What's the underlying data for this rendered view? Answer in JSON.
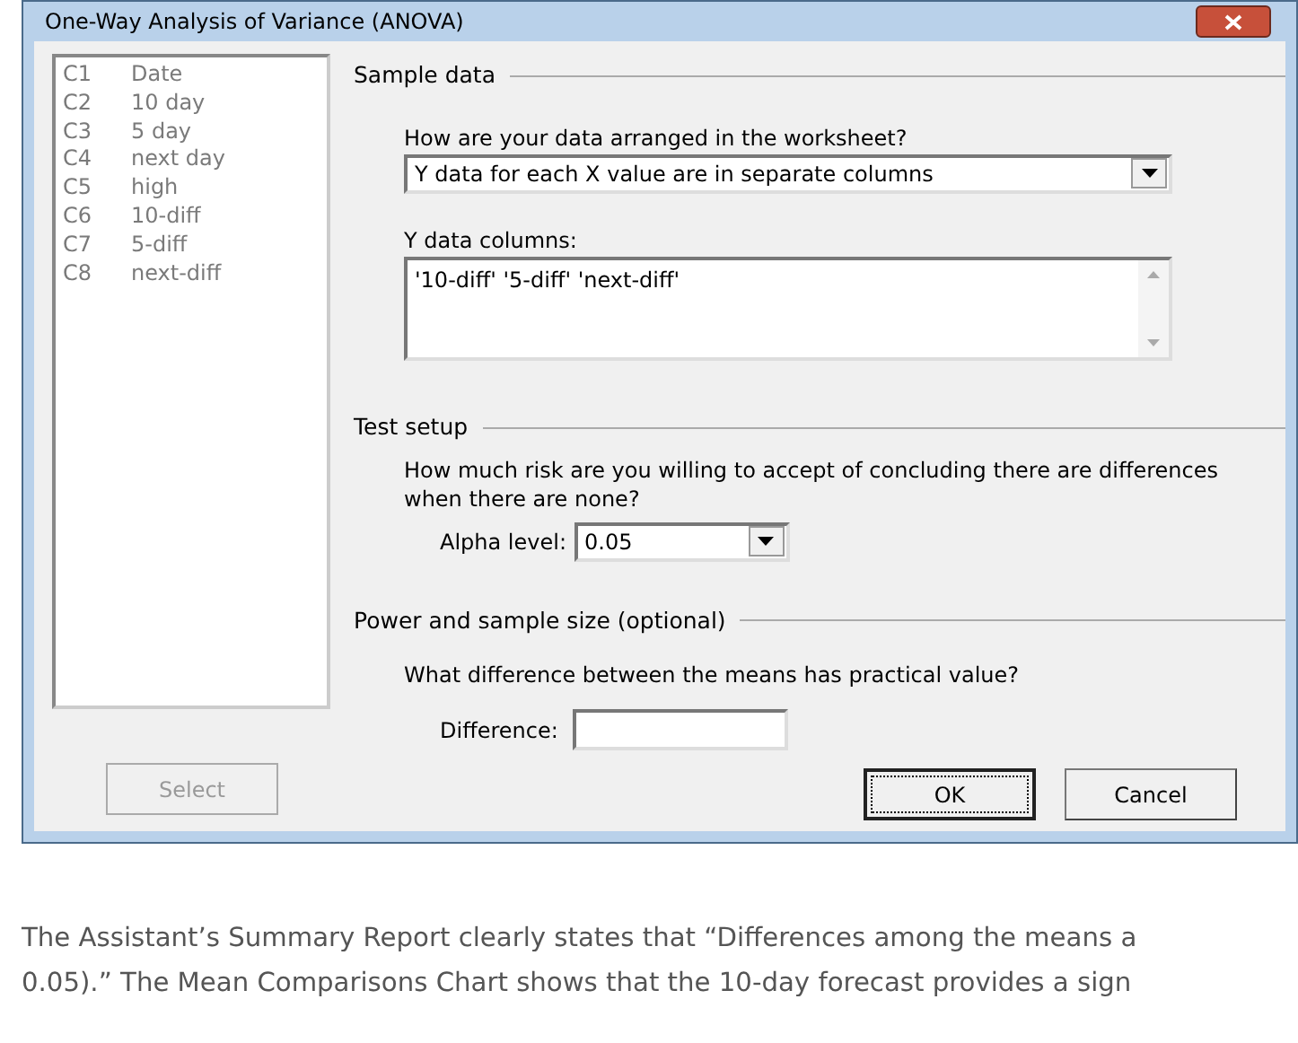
{
  "window": {
    "title": "One-Way Analysis of Variance (ANOVA)"
  },
  "columns": [
    {
      "id": "C1",
      "name": "Date"
    },
    {
      "id": "C2",
      "name": "10 day"
    },
    {
      "id": "C3",
      "name": "5 day"
    },
    {
      "id": "C4",
      "name": "next day"
    },
    {
      "id": "C5",
      "name": "high"
    },
    {
      "id": "C6",
      "name": "10-diff"
    },
    {
      "id": "C7",
      "name": "5-diff"
    },
    {
      "id": "C8",
      "name": "next-diff"
    }
  ],
  "select_button": {
    "label": "Select",
    "disabled": true
  },
  "sample_data": {
    "heading": "Sample data",
    "arrangement_label": "How are your data arranged in the worksheet?",
    "arrangement_value": "Y data for each X value are in separate columns",
    "y_columns_label": "Y data columns:",
    "y_columns_value": "'10-diff' '5-diff' 'next-diff'"
  },
  "test_setup": {
    "heading": "Test setup",
    "question": "How much risk are you willing to accept of concluding there are differences when there are none?",
    "alpha_label": "Alpha level:",
    "alpha_value": "0.05"
  },
  "power": {
    "heading": "Power and sample size (optional)",
    "question": "What difference between the means has practical value?",
    "difference_label": "Difference:"
  },
  "buttons": [
    {
      "label": "OK",
      "default": true
    },
    {
      "label": "Cancel",
      "default": false
    }
  ],
  "article_lines": [
    "The Assistant’s Summary Report clearly states that “Differences among the means a",
    "0.05).” The Mean Comparisons Chart shows that the 10-day forecast provides a sign"
  ]
}
